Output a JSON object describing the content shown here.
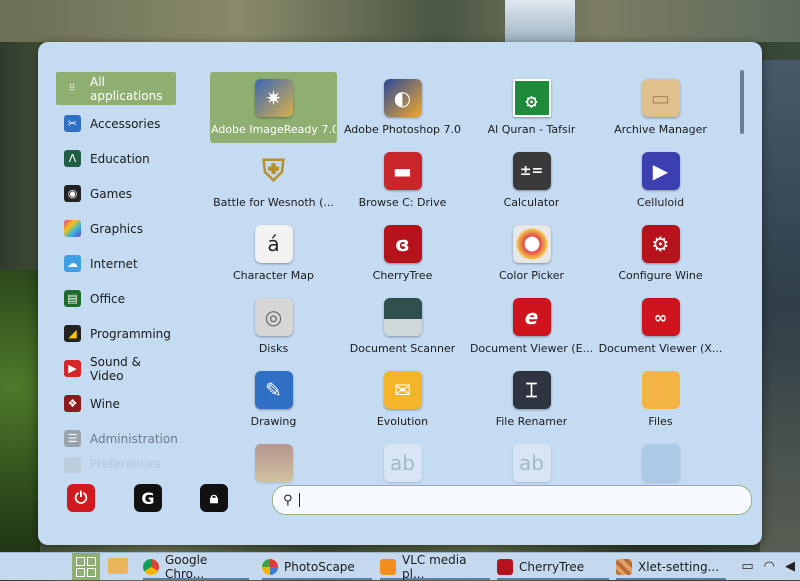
{
  "categories": [
    {
      "label": "All applications",
      "icon": "grid-icon"
    },
    {
      "label": "Accessories",
      "icon": "scissors-icon"
    },
    {
      "label": "Education",
      "icon": "education-icon"
    },
    {
      "label": "Games",
      "icon": "gamepad-icon"
    },
    {
      "label": "Graphics",
      "icon": "graphics-icon"
    },
    {
      "label": "Internet",
      "icon": "cloud-icon"
    },
    {
      "label": "Office",
      "icon": "office-icon"
    },
    {
      "label": "Programming",
      "icon": "programming-icon"
    },
    {
      "label": "Sound & Video",
      "icon": "play-icon"
    },
    {
      "label": "Wine",
      "icon": "wine-icon"
    },
    {
      "label": "Administration",
      "icon": "administration-icon"
    },
    {
      "label": "Preferences",
      "icon": "preferences-icon"
    }
  ],
  "apps": [
    {
      "label": "Adobe ImageReady 7.0",
      "icon": "imageready-icon"
    },
    {
      "label": "Adobe Photoshop 7.0",
      "icon": "photoshop-icon"
    },
    {
      "label": "Al Quran - Tafsir",
      "icon": "quran-icon"
    },
    {
      "label": "Archive Manager",
      "icon": "archive-icon"
    },
    {
      "label": "Battle for Wesnoth (...",
      "icon": "wesnoth-icon"
    },
    {
      "label": "Browse C: Drive",
      "icon": "folder-icon"
    },
    {
      "label": "Calculator",
      "icon": "calculator-icon"
    },
    {
      "label": "Celluloid",
      "icon": "play-icon"
    },
    {
      "label": "Character Map",
      "icon": "character-map-icon"
    },
    {
      "label": "CherryTree",
      "icon": "cherry-icon"
    },
    {
      "label": "Color Picker",
      "icon": "color-picker-icon"
    },
    {
      "label": "Configure Wine",
      "icon": "gear-icon"
    },
    {
      "label": "Disks",
      "icon": "disk-icon"
    },
    {
      "label": "Document Scanner",
      "icon": "scanner-icon"
    },
    {
      "label": "Document Viewer (E...",
      "icon": "ebook-viewer-icon"
    },
    {
      "label": "Document Viewer (X...",
      "icon": "glasses-icon"
    },
    {
      "label": "Drawing",
      "icon": "pencil-icon"
    },
    {
      "label": "Evolution",
      "icon": "envelope-icon"
    },
    {
      "label": "File Renamer",
      "icon": "renamer-icon"
    },
    {
      "label": "Files",
      "icon": "files-folder-icon"
    }
  ],
  "search": {
    "placeholder": "",
    "value": ""
  },
  "power_buttons": [
    "power-icon",
    "logout-icon",
    "lock-icon"
  ],
  "taskbar": {
    "tasks": [
      {
        "label": "Google Chro...",
        "icon": "chrome-icon"
      },
      {
        "label": "PhotoScape",
        "icon": "photoscape-icon"
      },
      {
        "label": "VLC media pl...",
        "icon": "vlc-icon"
      },
      {
        "label": "CherryTree",
        "icon": "cherry-icon"
      },
      {
        "label": "Xlet-setting...",
        "icon": "xlet-icon"
      }
    ],
    "tray": [
      "display-icon",
      "wifi-icon",
      "volume-icon"
    ]
  },
  "colors": {
    "menu_bg": "#c4dbf2",
    "selected": "#8fae71",
    "taskbar_bg": "#c5d9ee"
  }
}
